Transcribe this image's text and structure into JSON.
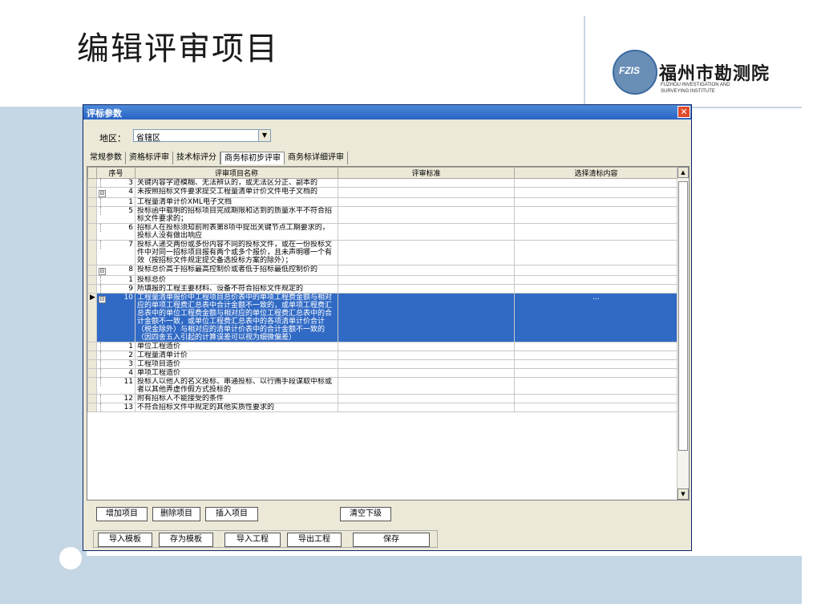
{
  "slide": {
    "title": "编辑评审项目"
  },
  "logo": {
    "badge": "FZIS",
    "name_cn": "福州市勘测院",
    "name_en_1": "FUZHOU INVESTIGATION AND",
    "name_en_2": "SURVEYING INSTITUTE"
  },
  "window": {
    "title": "评标参数",
    "close": "✕"
  },
  "region": {
    "label": "地区：",
    "value": "省辖区",
    "arrow": "▼"
  },
  "tabs": [
    "常规参数",
    "资格标评审",
    "技术标评分",
    "商务标初步评审",
    "商务标详细评审"
  ],
  "grid": {
    "columns": [
      "序号",
      "评审项目名称",
      "评审标准",
      "选择清标内容"
    ],
    "rows": [
      {
        "expander": "",
        "indicator": "",
        "seq": "3",
        "name": "关键内容字迹模糊、无法辨认的，或无法区分正、副本的",
        "standard": "",
        "content": ""
      },
      {
        "expander": "⊟",
        "indicator": "",
        "seq": "4",
        "name": "未按照招标文件要求提交工程量清单计价文件电子文档的",
        "standard": "",
        "content": ""
      },
      {
        "expander": "",
        "indicator": "",
        "seq": "1",
        "name": "工程量清单计价XML电子文档",
        "standard": "",
        "content": ""
      },
      {
        "expander": "",
        "indicator": "",
        "seq": "5",
        "name": "投标函中载明的招标项目完成期限和达到的质量水平不符合招标文件要求的；",
        "standard": "",
        "content": ""
      },
      {
        "expander": "",
        "indicator": "",
        "seq": "6",
        "name": "招标人在投标须知前附表第8项中提出关键节点工期要求的，投标人没有做出响应",
        "standard": "",
        "content": ""
      },
      {
        "expander": "",
        "indicator": "",
        "seq": "7",
        "name": "投标人递交两份或多份内容不同的投标文件，或在一份投标文件中对同一招标项目报有两个或多个报价，且未声明哪一个有效（按招标文件规定提交备选投标方案的除外）；",
        "standard": "",
        "content": ""
      },
      {
        "expander": "⊟",
        "indicator": "",
        "seq": "8",
        "name": "投标总价高于招标最高控制价或者低于招标最低控制价的",
        "standard": "",
        "content": ""
      },
      {
        "expander": "",
        "indicator": "",
        "seq": "1",
        "name": "投标总价",
        "standard": "",
        "content": ""
      },
      {
        "expander": "",
        "indicator": "",
        "seq": "9",
        "name": "所填报的工程主要材料、设备不符合招标文件规定的",
        "standard": "",
        "content": ""
      },
      {
        "expander": "⊟",
        "indicator": "▶",
        "seq": "10",
        "name": "工程量清单报价中工程项目总价表中的单项工程费金额与相对应的单项工程费汇总表中合计金额不一致的，或单项工程费汇总表中的单位工程费金额与相对应的单位工程费汇总表中的合计金额不一致，或单位工程费汇总表中的各项清单计价合计（税金除外）与相对应的清单计价表中的合计金额不一致的（因四舍五入引起的计算误差可以视为细微偏差）",
        "standard": "",
        "content": "..."
      },
      {
        "expander": "",
        "indicator": "",
        "seq": "1",
        "name": "单位工程造价",
        "standard": "",
        "content": ""
      },
      {
        "expander": "",
        "indicator": "",
        "seq": "2",
        "name": "工程量清单计价",
        "standard": "",
        "content": ""
      },
      {
        "expander": "",
        "indicator": "",
        "seq": "3",
        "name": "工程项目造价",
        "standard": "",
        "content": ""
      },
      {
        "expander": "",
        "indicator": "",
        "seq": "4",
        "name": "单项工程造价",
        "standard": "",
        "content": ""
      },
      {
        "expander": "",
        "indicator": "",
        "seq": "11",
        "name": "投标人以他人的名义投标、串通投标、以行贿手段谋取中标或者以其他弄虚作假方式投标的",
        "standard": "",
        "content": ""
      },
      {
        "expander": "",
        "indicator": "",
        "seq": "12",
        "name": "附有招标人不能接受的条件",
        "standard": "",
        "content": ""
      },
      {
        "expander": "",
        "indicator": "",
        "seq": "13",
        "name": "不符合招标文件中规定的其他实质性要求的",
        "standard": "",
        "content": ""
      }
    ]
  },
  "scrollbar": {
    "up": "▲",
    "down": "▼"
  },
  "buttons": {
    "add": "增加项目",
    "delete": "删除项目",
    "insert": "插入项目",
    "clear": "清空下级",
    "import_template": "导入模板",
    "save_template": "存为模板",
    "import_project": "导入工程",
    "export_project": "导出工程",
    "save": "保存"
  }
}
